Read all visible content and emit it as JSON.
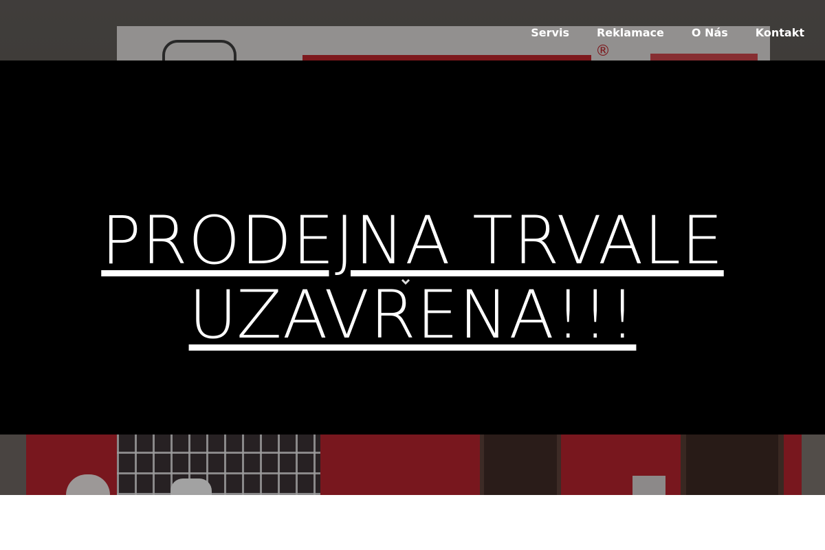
{
  "nav": {
    "items": [
      {
        "label": "Servis"
      },
      {
        "label": "Reklamace"
      },
      {
        "label": "O Nás"
      },
      {
        "label": "Kontakt"
      }
    ]
  },
  "hero": {
    "headline_line1": "PRODEJNA TRVALE",
    "headline_line2": "UZAVRENA!!!",
    "sign_registered_mark": "®"
  },
  "colors": {
    "banner": "#000000",
    "storefront_red": "#b2232d",
    "nav_text": "#ffffff"
  },
  "icons": {
    "scroll_indicator": "chevron-down-icon"
  }
}
